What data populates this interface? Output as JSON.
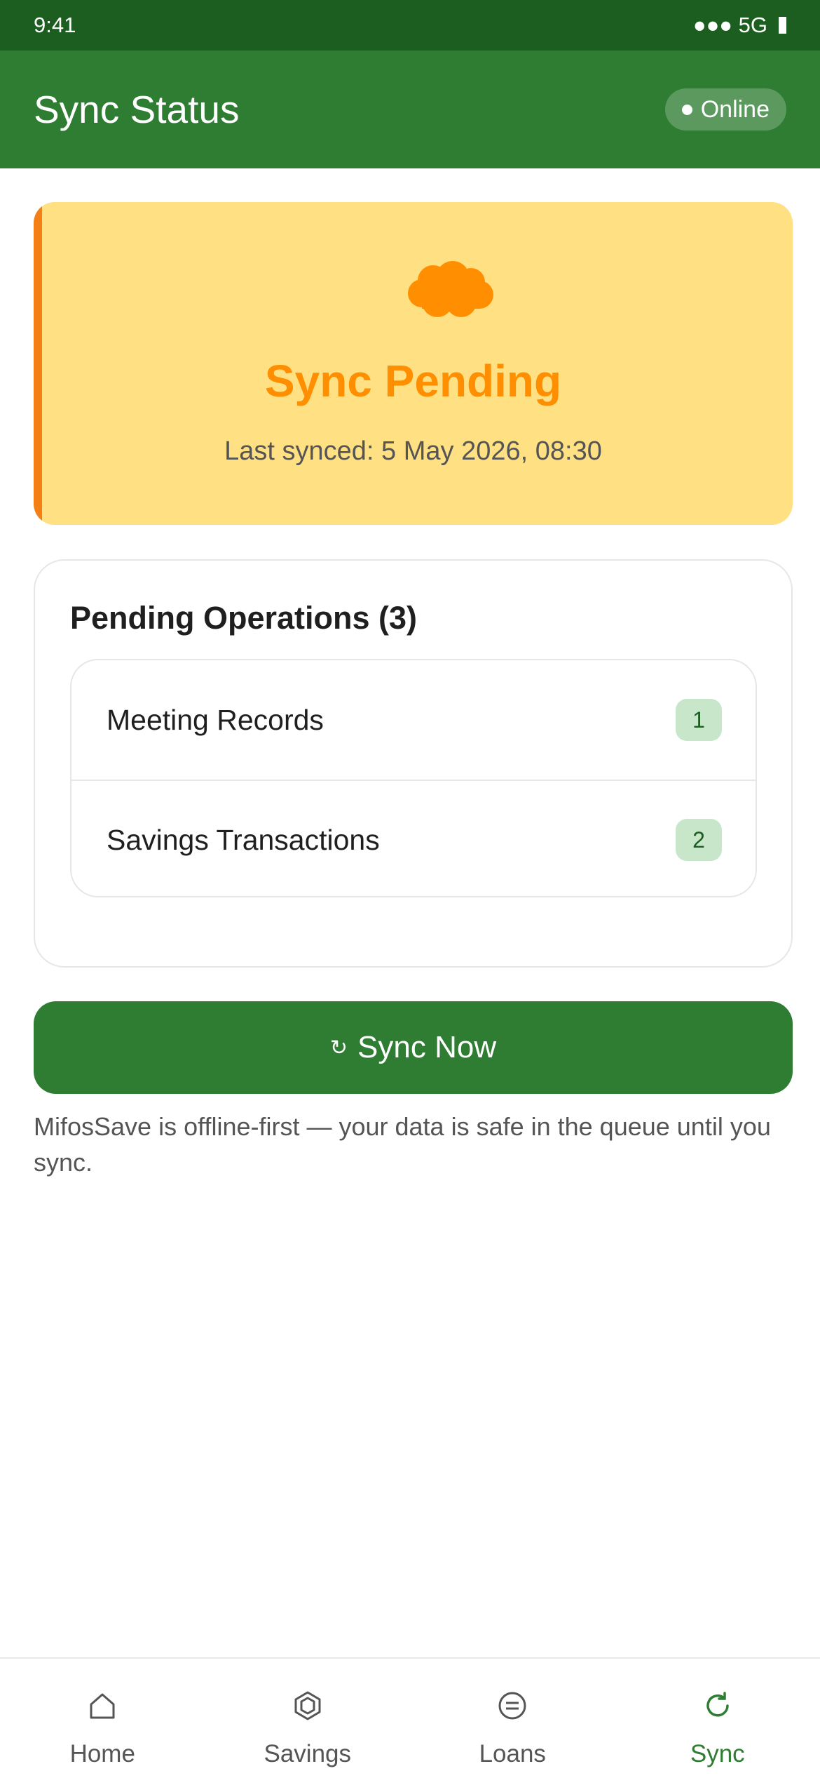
{
  "status_bar": {
    "time": "9:41",
    "signal": "●●● 5G",
    "battery_icon": "battery-icon"
  },
  "app_bar": {
    "title": "Sync Status",
    "connection_status": "Online"
  },
  "sync_status": {
    "icon": "cloud-icon",
    "title": "Sync Pending",
    "last_synced": "Last synced: 5 May 2026, 08:30",
    "colors": {
      "background": "#ffe082",
      "accent": "#ff8f00",
      "stripe": "#f57f17"
    }
  },
  "pending_operations": {
    "title": "Pending Operations (3)",
    "items": [
      {
        "label": "Meeting Records",
        "count": "1"
      },
      {
        "label": "Savings Transactions",
        "count": "2"
      }
    ]
  },
  "sync_button": {
    "icon": "↻",
    "label": "Sync Now"
  },
  "footnote": "MifosSave is offline-first — your data is safe in the queue until you sync.",
  "bottom_nav": {
    "items": [
      {
        "label": "Home",
        "icon": "home-icon",
        "active": false
      },
      {
        "label": "Savings",
        "icon": "savings-icon",
        "active": false
      },
      {
        "label": "Loans",
        "icon": "loans-icon",
        "active": false
      },
      {
        "label": "Sync",
        "icon": "sync-icon",
        "active": true
      }
    ]
  },
  "colors": {
    "primary": "#2e7d32",
    "primary_dark": "#1b5e20",
    "badge_bg": "#c8e6c9"
  }
}
